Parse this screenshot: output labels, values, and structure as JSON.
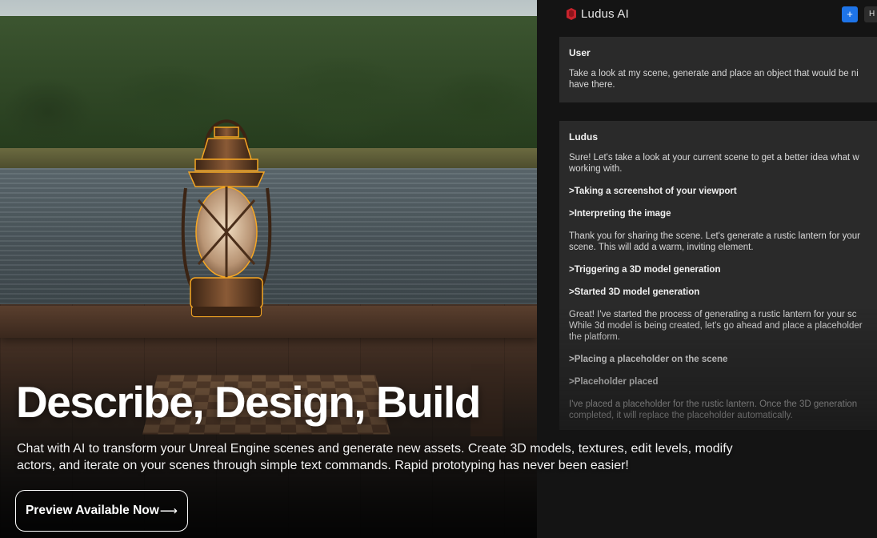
{
  "panel": {
    "brand": "Ludus AI",
    "buttons": {
      "new_label": "+",
      "h_label": "H"
    },
    "user_card": {
      "title": "User",
      "lines": [
        "Take a look at my scene, generate and place an object that would be ni",
        "have there."
      ]
    },
    "ludus_card": {
      "title": "Ludus",
      "entries": [
        {
          "kind": "text",
          "lines": [
            "Sure! Let's take a look at your current scene to get a better idea what w",
            "working with."
          ]
        },
        {
          "kind": "action",
          "text": ">Taking a screenshot of your viewport"
        },
        {
          "kind": "action",
          "text": ">Interpreting the image"
        },
        {
          "kind": "text",
          "lines": [
            "Thank you for sharing the scene. Let's generate a rustic lantern for your",
            "scene. This will add a warm, inviting element."
          ]
        },
        {
          "kind": "action",
          "text": ">Triggering a 3D model generation"
        },
        {
          "kind": "action",
          "text": ">Started 3D model generation"
        },
        {
          "kind": "text",
          "lines": [
            "Great! I've started the process of generating a rustic lantern for your sc",
            "While 3d model is being created, let's go ahead and place a placeholder",
            "the platform."
          ]
        },
        {
          "kind": "action",
          "text": ">Placing a placeholder on the scene"
        },
        {
          "kind": "action",
          "text": ">Placeholder placed"
        },
        {
          "kind": "text",
          "lines": [
            "I've placed a placeholder for the rustic lantern. Once the 3D generation",
            "completed, it will replace the placeholder automatically."
          ]
        }
      ]
    }
  },
  "hero": {
    "headline": "Describe, Design, Build",
    "subtext": "Chat with AI to transform your Unreal Engine scenes and generate new assets. Create 3D models, textures, edit levels, modify actors, and iterate on your scenes through simple text commands. Rapid prototyping has never been easier!",
    "cta_label": "Preview Available Now",
    "cta_arrow": "⟶"
  },
  "colors": {
    "accent_blue": "#1e74e8",
    "lantern_outline": "#f5a623",
    "card_bg": "#2a2a2a",
    "brand_logo": "#c8232c"
  },
  "icons": {
    "brand_logo": "ludus-logo-icon",
    "arrow": "arrow-right-icon"
  }
}
